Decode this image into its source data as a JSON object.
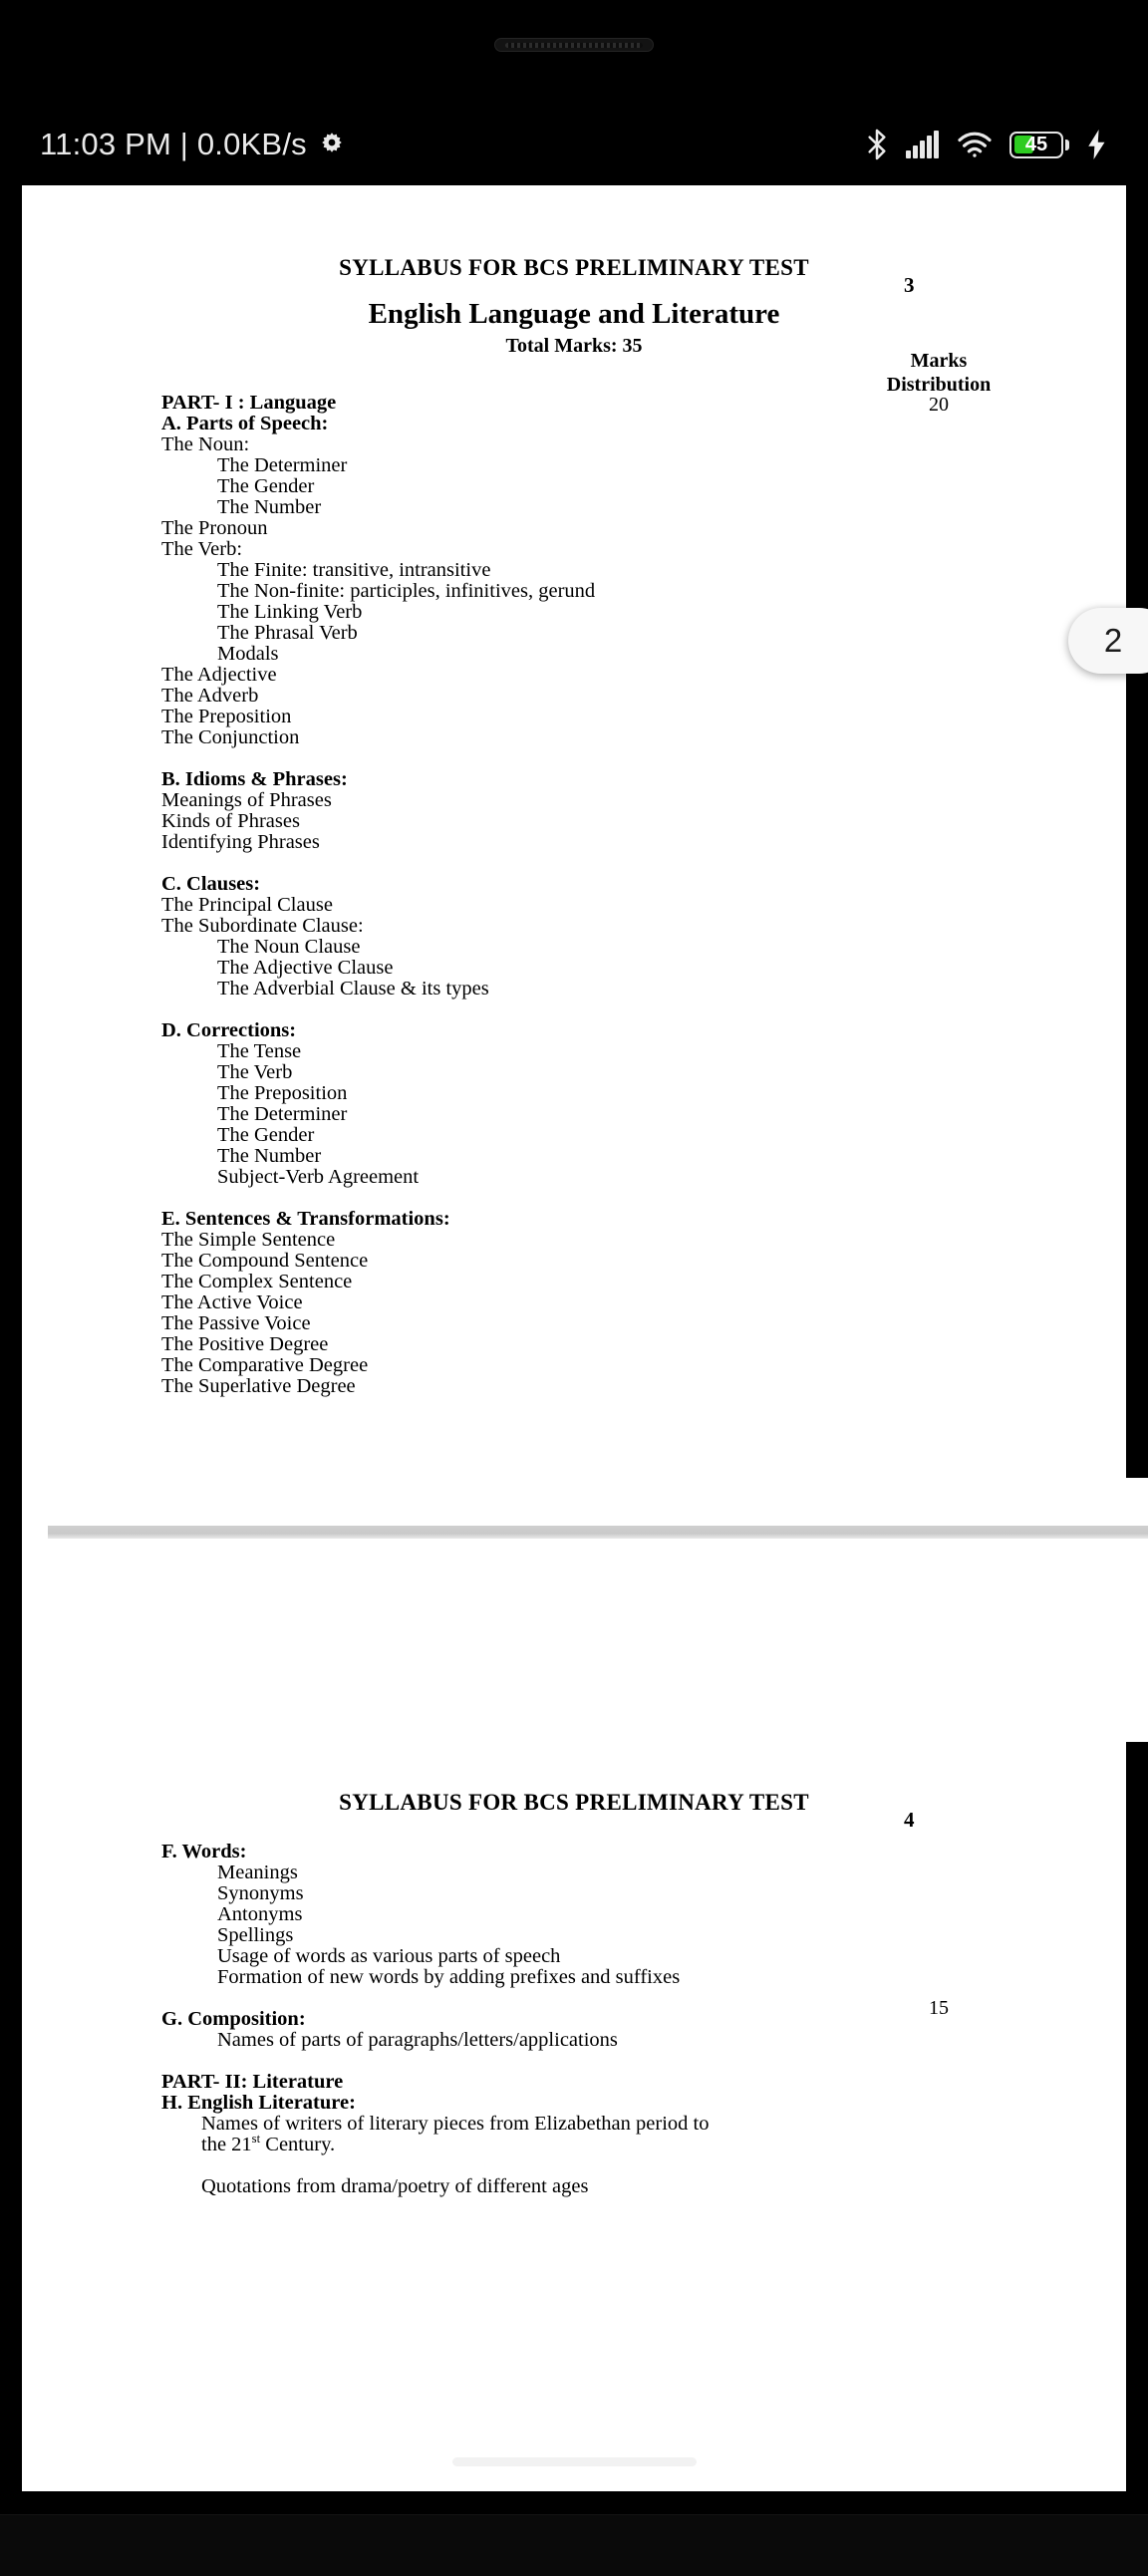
{
  "status_bar": {
    "time_and_speed": "11:03 PM | 0.0KB/s",
    "gear_icon": "gear-icon",
    "bluetooth_icon": "bluetooth-icon",
    "signal_icon": "cellular-signal-icon",
    "wifi_icon": "wifi-icon",
    "battery_percent": "45",
    "charging_icon": "charging-bolt-icon",
    "battery_fill_color": "#2ecc21"
  },
  "page_indicator": {
    "label": "2"
  },
  "document": {
    "pages": [
      {
        "header": "SYLLABUS FOR BCS PRELIMINARY TEST",
        "page_number": "3",
        "subject_title": "English Language and Literature",
        "total_marks": "Total Marks: 35",
        "marks_column_header_line1": "Marks",
        "marks_column_header_line2": "Distribution",
        "marks_value": "20",
        "lines": [
          {
            "text": "PART- I : Language",
            "bold": true,
            "indent": 1
          },
          {
            "text": "A. Parts of Speech:",
            "bold": true,
            "indent": 1
          },
          {
            "text": "The Noun:",
            "bold": false,
            "indent": 1
          },
          {
            "text": "The Determiner",
            "bold": false,
            "indent": 2
          },
          {
            "text": "The Gender",
            "bold": false,
            "indent": 2
          },
          {
            "text": "The Number",
            "bold": false,
            "indent": 2
          },
          {
            "text": "The Pronoun",
            "bold": false,
            "indent": 1
          },
          {
            "text": "The Verb:",
            "bold": false,
            "indent": 1
          },
          {
            "text": "The Finite: transitive, intransitive",
            "bold": false,
            "indent": 2
          },
          {
            "text": "The Non-finite: participles, infinitives, gerund",
            "bold": false,
            "indent": 2
          },
          {
            "text": "The Linking Verb",
            "bold": false,
            "indent": 2
          },
          {
            "text": "The Phrasal Verb",
            "bold": false,
            "indent": 2
          },
          {
            "text": "Modals",
            "bold": false,
            "indent": 2
          },
          {
            "text": "The Adjective",
            "bold": false,
            "indent": 1
          },
          {
            "text": "The Adverb",
            "bold": false,
            "indent": 1
          },
          {
            "text": "The Preposition",
            "bold": false,
            "indent": 1
          },
          {
            "text": "The Conjunction",
            "bold": false,
            "indent": 1
          },
          {
            "text": "",
            "bold": false,
            "indent": 1
          },
          {
            "text": "B. Idioms & Phrases:",
            "bold": true,
            "indent": 1
          },
          {
            "text": "Meanings of Phrases",
            "bold": false,
            "indent": 1
          },
          {
            "text": "Kinds of Phrases",
            "bold": false,
            "indent": 1
          },
          {
            "text": "Identifying Phrases",
            "bold": false,
            "indent": 1
          },
          {
            "text": "",
            "bold": false,
            "indent": 1
          },
          {
            "text": "C. Clauses:",
            "bold": true,
            "indent": 1
          },
          {
            "text": "The Principal Clause",
            "bold": false,
            "indent": 1
          },
          {
            "text": "The Subordinate Clause:",
            "bold": false,
            "indent": 1
          },
          {
            "text": "The Noun Clause",
            "bold": false,
            "indent": 2
          },
          {
            "text": "The Adjective Clause",
            "bold": false,
            "indent": 2
          },
          {
            "text": "The Adverbial Clause & its types",
            "bold": false,
            "indent": 2
          },
          {
            "text": "",
            "bold": false,
            "indent": 1
          },
          {
            "text": "D. Corrections:",
            "bold": true,
            "indent": 1
          },
          {
            "text": "The Tense",
            "bold": false,
            "indent": 2
          },
          {
            "text": "The Verb",
            "bold": false,
            "indent": 2
          },
          {
            "text": "The Preposition",
            "bold": false,
            "indent": 2
          },
          {
            "text": "The Determiner",
            "bold": false,
            "indent": 2
          },
          {
            "text": "The Gender",
            "bold": false,
            "indent": 2
          },
          {
            "text": "The Number",
            "bold": false,
            "indent": 2
          },
          {
            "text": "Subject-Verb Agreement",
            "bold": false,
            "indent": 2
          },
          {
            "text": "",
            "bold": false,
            "indent": 1
          },
          {
            "text": "E. Sentences & Transformations:",
            "bold": true,
            "indent": 1
          },
          {
            "text": "The Simple Sentence",
            "bold": false,
            "indent": 1
          },
          {
            "text": "The Compound Sentence",
            "bold": false,
            "indent": 1
          },
          {
            "text": "The Complex Sentence",
            "bold": false,
            "indent": 1
          },
          {
            "text": "The Active Voice",
            "bold": false,
            "indent": 1
          },
          {
            "text": "The Passive Voice",
            "bold": false,
            "indent": 1
          },
          {
            "text": "The Positive Degree",
            "bold": false,
            "indent": 1
          },
          {
            "text": "The Comparative Degree",
            "bold": false,
            "indent": 1
          },
          {
            "text": "The Superlative Degree",
            "bold": false,
            "indent": 1
          }
        ]
      },
      {
        "header": "SYLLABUS FOR BCS PRELIMINARY TEST",
        "page_number": "4",
        "marks_value": "15",
        "lines": [
          {
            "text": "F. Words:",
            "bold": true,
            "indent": 1
          },
          {
            "text": "Meanings",
            "bold": false,
            "indent": 2
          },
          {
            "text": "Synonyms",
            "bold": false,
            "indent": 2
          },
          {
            "text": "Antonyms",
            "bold": false,
            "indent": 2
          },
          {
            "text": "Spellings",
            "bold": false,
            "indent": 2
          },
          {
            "text": "Usage of words as various parts of speech",
            "bold": false,
            "indent": 2
          },
          {
            "text": "Formation of new words by adding prefixes and suffixes",
            "bold": false,
            "indent": 2
          },
          {
            "text": "",
            "bold": false,
            "indent": 1
          },
          {
            "text": "G. Composition:",
            "bold": true,
            "indent": 1
          },
          {
            "text": "Names of parts of paragraphs/letters/applications",
            "bold": false,
            "indent": 2
          },
          {
            "text": "",
            "bold": false,
            "indent": 1
          },
          {
            "text": "PART- II: Literature",
            "bold": true,
            "indent": 1
          },
          {
            "text": "H. English Literature:",
            "bold": true,
            "indent": 1
          },
          {
            "text": "Names of writers of literary pieces from Elizabethan period to",
            "bold": false,
            "indent": 3
          },
          {
            "text": "the 21st Century.",
            "bold": false,
            "indent": 3,
            "superscript": "st",
            "sup_base": "the 21",
            "sup_tail": " Century."
          },
          {
            "text": "",
            "bold": false,
            "indent": 1
          },
          {
            "text": "Quotations from drama/poetry of different ages",
            "bold": false,
            "indent": 3
          }
        ]
      }
    ]
  },
  "nav_bar": {
    "home_handle": "home-gesture-handle"
  }
}
